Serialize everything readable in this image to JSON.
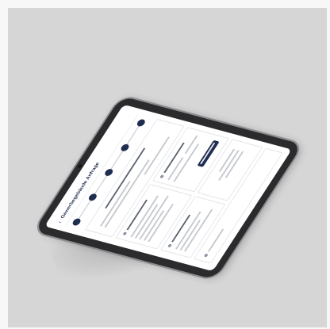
{
  "scene": {
    "device": "tablet",
    "background_color": "#d6d6d6",
    "accent_color": "#1f2d4f"
  },
  "app": {
    "title": "Gewerbegebäude Anfrage",
    "back_icon": "chevron-left-icon"
  },
  "stepper": {
    "step_count": 5,
    "current_step": 5
  }
}
